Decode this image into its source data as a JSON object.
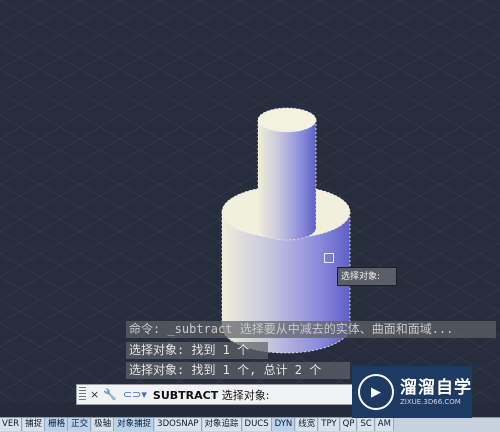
{
  "history": [
    "命令: _subtract 选择要从中减去的实体、曲面和面域...",
    "选择对象: 找到 1 个",
    "选择对象: 找到 1 个, 总计 2 个"
  ],
  "tooltip": {
    "text": "选择对象:"
  },
  "command_line": {
    "close_icon": "×",
    "settings_icon": "🔧",
    "prompt_icon": "⊂⊃▾",
    "command": "SUBTRACT",
    "prompt": "选择对象:"
  },
  "status_bar": [
    {
      "label": "VER",
      "on": false
    },
    {
      "label": "捕捉",
      "on": false
    },
    {
      "label": "栅格",
      "on": true
    },
    {
      "label": "正交",
      "on": true
    },
    {
      "label": "极轴",
      "on": false
    },
    {
      "label": "对象捕捉",
      "on": true
    },
    {
      "label": "3DOSNAP",
      "on": false
    },
    {
      "label": "对象追踪",
      "on": false
    },
    {
      "label": "DUCS",
      "on": false
    },
    {
      "label": "DYN",
      "on": true
    },
    {
      "label": "线宽",
      "on": false
    },
    {
      "label": "TPY",
      "on": false
    },
    {
      "label": "QP",
      "on": false
    },
    {
      "label": "SC",
      "on": false
    },
    {
      "label": "AM",
      "on": false
    }
  ],
  "watermark": {
    "title": "溜溜自学",
    "url": "ZIXUE.3D66.COM",
    "logo_icon": "▶"
  },
  "colors": {
    "viewport_bg": "#262d3c",
    "solid_light": "#f1f0dc",
    "solid_shade": "#5e60c6",
    "status_on": "#b9d3ee"
  }
}
